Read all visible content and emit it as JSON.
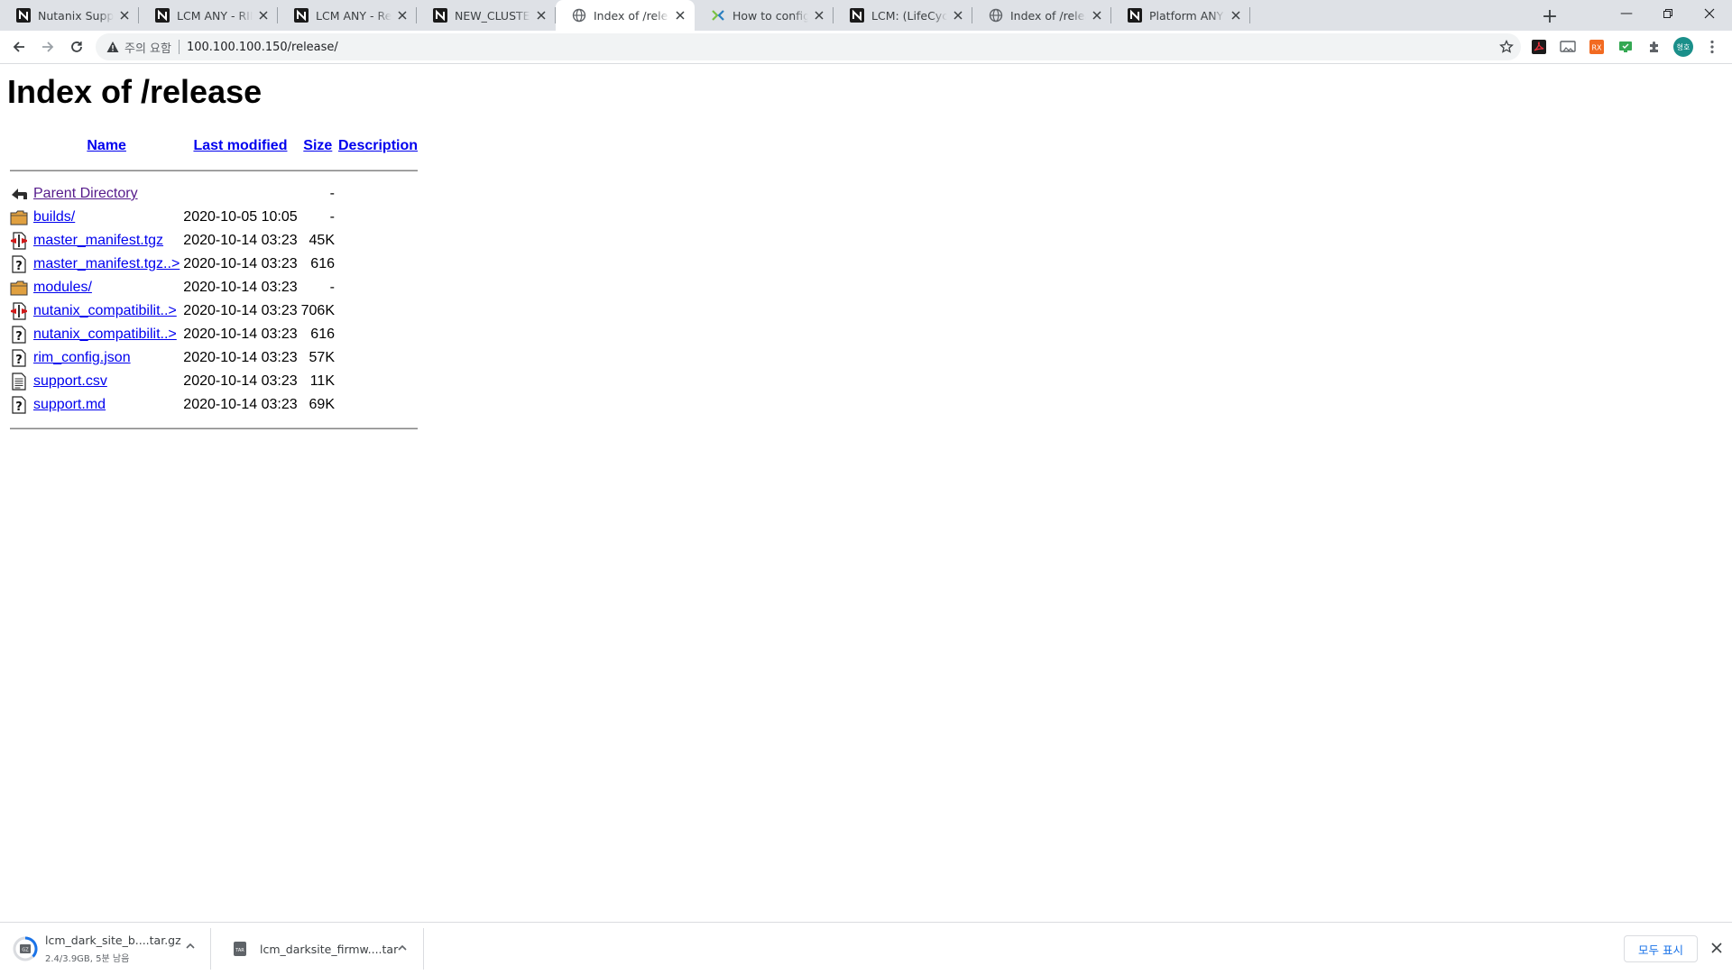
{
  "browser": {
    "tabs": [
      {
        "title": "Nutanix Support & Insights",
        "favicon": "nutanix-icon",
        "active": false
      },
      {
        "title": "LCM ANY - RIM Payload",
        "favicon": "nutanix-icon",
        "active": false
      },
      {
        "title": "LCM ANY - Release Notes",
        "favicon": "nutanix-icon",
        "active": false
      },
      {
        "title": "NEW_CLUSTER - Prism",
        "favicon": "nutanix-icon",
        "active": false
      },
      {
        "title": "Index of /release",
        "favicon": "globe-icon",
        "active": true
      },
      {
        "title": "How to configure a web server",
        "favicon": "nutanix-x-icon",
        "active": false
      },
      {
        "title": "LCM: (LifeCycle Manager)",
        "favicon": "nutanix-icon",
        "active": false
      },
      {
        "title": "Index of /release",
        "favicon": "globe-icon",
        "active": false
      },
      {
        "title": "Platform ANY - Replace",
        "favicon": "nutanix-icon",
        "active": false
      }
    ],
    "new_tab_label": "+",
    "address_bar": {
      "security_label": "주의 요함",
      "url": "100.100.100.150/release/"
    },
    "profile_initials": "형호"
  },
  "page": {
    "heading": "Index of /release",
    "columns": {
      "name": "Name",
      "last_modified": "Last modified",
      "size": "Size",
      "description": "Description"
    },
    "rows": [
      {
        "icon": "back-icon",
        "name": "Parent Directory",
        "modified": "",
        "size": "-",
        "visited": true
      },
      {
        "icon": "folder-icon",
        "name": "builds/",
        "modified": "2020-10-05 10:05",
        "size": "-",
        "visited": false
      },
      {
        "icon": "compressed-file-icon",
        "name": "master_manifest.tgz",
        "modified": "2020-10-14 03:23",
        "size": "45K",
        "visited": false
      },
      {
        "icon": "unknown-file-icon",
        "name": "master_manifest.tgz..>",
        "modified": "2020-10-14 03:23",
        "size": "616",
        "visited": false
      },
      {
        "icon": "folder-icon",
        "name": "modules/",
        "modified": "2020-10-14 03:23",
        "size": "-",
        "visited": false
      },
      {
        "icon": "compressed-file-icon",
        "name": "nutanix_compatibilit..>",
        "modified": "2020-10-14 03:23",
        "size": "706K",
        "visited": false
      },
      {
        "icon": "unknown-file-icon",
        "name": "nutanix_compatibilit..>",
        "modified": "2020-10-14 03:23",
        "size": "616",
        "visited": false
      },
      {
        "icon": "unknown-file-icon",
        "name": "rim_config.json",
        "modified": "2020-10-14 03:23",
        "size": "57K",
        "visited": false
      },
      {
        "icon": "text-file-icon",
        "name": "support.csv",
        "modified": "2020-10-14 03:23",
        "size": "11K",
        "visited": false
      },
      {
        "icon": "unknown-file-icon",
        "name": "support.md",
        "modified": "2020-10-14 03:23",
        "size": "69K",
        "visited": false
      }
    ]
  },
  "downloads": {
    "items": [
      {
        "name": "lcm_dark_site_b....tar.gz",
        "status": "2.4/3.9GB, 5분 남음",
        "icon": "download-progress-icon"
      },
      {
        "name": "lcm_darksite_firmw....tar",
        "status": "",
        "icon": "tar-file-icon"
      }
    ],
    "show_all_label": "모두 표시"
  }
}
